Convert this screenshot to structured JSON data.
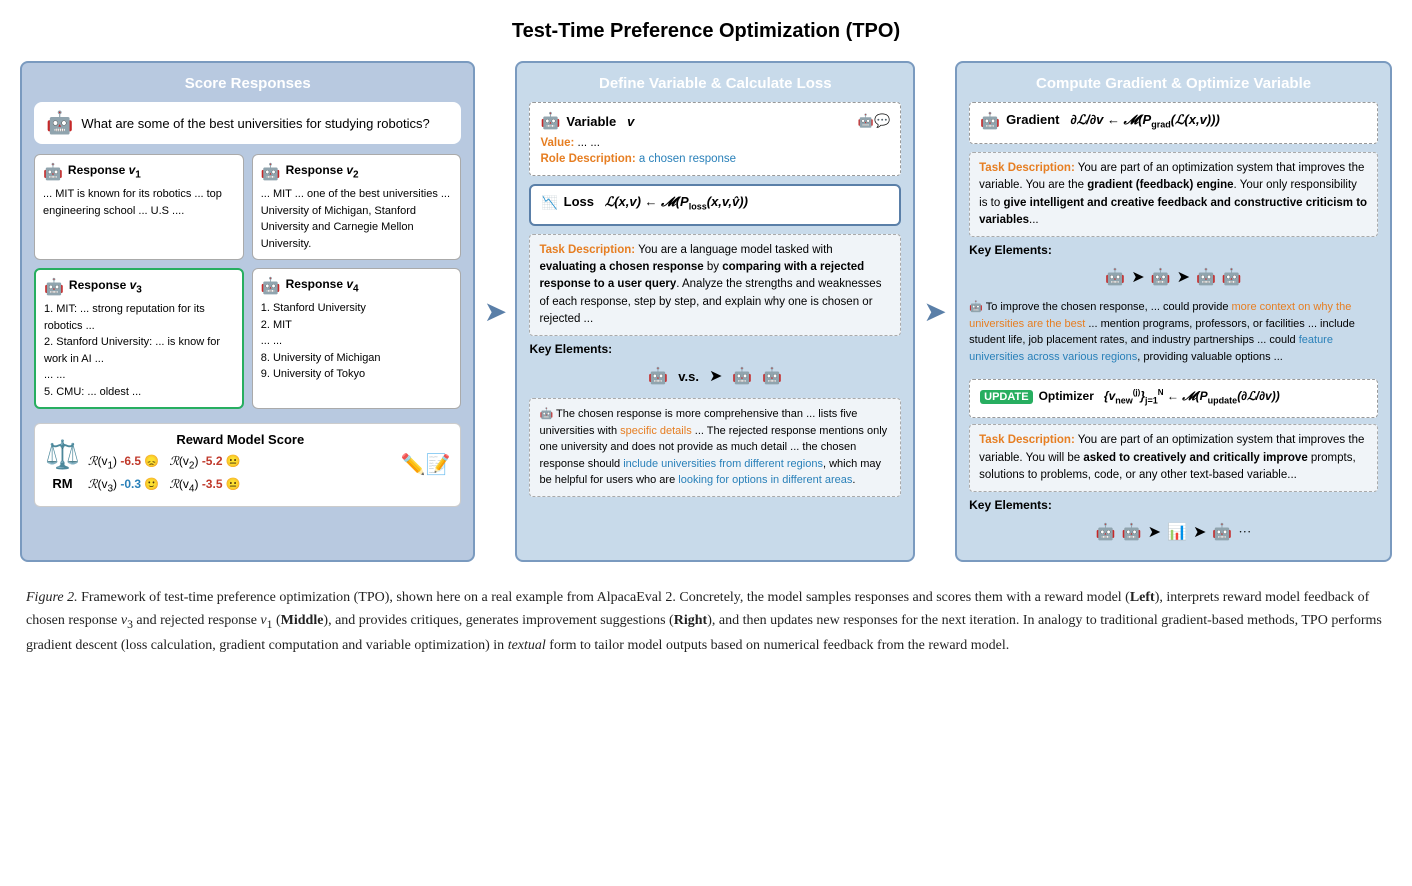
{
  "page": {
    "title": "Test-Time Preference Optimization (TPO)"
  },
  "left_panel": {
    "title": "Score Responses",
    "question": "What are some of the best universities for studying robotics?",
    "responses": [
      {
        "label": "Response",
        "subscript": "v₁",
        "text": "... MIT is known for its robotics ... top engineering school ... U.S ...."
      },
      {
        "label": "Response",
        "subscript": "v₂",
        "text": "... MIT ... one of the best universities ... University of Michigan, Stanford University and Carnegie Mellon University."
      },
      {
        "label": "Response",
        "subscript": "v₃",
        "text": "1. MIT: ... strong reputation for its robotics ...\n2. Stanford University: ... is know for work in AI ...\n... ...\n5. CMU: ... oldest ..."
      },
      {
        "label": "Response",
        "subscript": "v₄",
        "text": "1. Stanford University\n2. MIT\n... ...\n8. University of Michigan\n9. University of Tokyo"
      }
    ],
    "reward_title": "Reward Model Score",
    "scores": [
      {
        "label": "ℛ(v₁)",
        "value": "-6.5",
        "emoji": "😞"
      },
      {
        "label": "ℛ(v₂)",
        "value": "-5.2",
        "emoji": "😐"
      },
      {
        "label": "ℛ(v₃)",
        "value": "-0.3",
        "emoji": "🙂"
      },
      {
        "label": "ℛ(v₄)",
        "value": "-3.5",
        "emoji": "😐"
      }
    ]
  },
  "middle_panel": {
    "title": "Define Variable & Calculate Loss",
    "variable_label": "Variable",
    "variable_var": "v",
    "value_label": "Value:",
    "value_text": "... ...",
    "role_label": "Role Description:",
    "role_text": "a chosen response",
    "loss_label": "Loss",
    "loss_formula": "ℒ(x,v) ← 𝓜(P_loss(x,v,v̂))",
    "task_desc_loss": "Task Description: You are a language model tasked with evaluating a chosen response by comparing with a rejected response to a user query. Analyze the strengths and weaknesses of each response, step by step, and explain why one is chosen or rejected ...",
    "key_elements": "Key Elements:",
    "chosen_feedback": "The chosen response is more comprehensive than ... lists five universities with specific details ... The rejected response mentions only one university and does not provide as much detail ... the chosen response should include universities from different regions, which may be helpful for users who are looking for options in different areas."
  },
  "right_panel": {
    "title": "Compute Gradient & Optimize Variable",
    "gradient_label": "Gradient",
    "gradient_formula": "∂ℒ/∂v ← 𝓜(P_grad(ℒ(x,v)))",
    "task_desc_gradient": "Task Description: You are part of an optimization system that improves the variable. You are the gradient (feedback) engine. Your only responsibility is to give intelligent and creative feedback and constructive criticism to variables...",
    "key_elements_gradient": "Key Elements:",
    "improvement_text": "To improve the chosen response, ... could provide more context on why the universities are the best ... mention programs, professors, or facilities ... include student life, job placement rates, and industry partnerships ... could feature universities across various regions, providing valuable options ...",
    "optimizer_label": "Optimizer",
    "optimizer_formula": "{v_new^(j)}_{j=1}^N ← 𝓜(P_update(∂ℒ/∂v))",
    "task_desc_optimizer": "Task Description: You are part of an optimization system that improves the variable. You will be asked to creatively and critically improve prompts, solutions to problems, code, or any other text-based variable...",
    "key_elements_optimizer": "Key Elements:"
  },
  "caption": {
    "fig_label": "Figure 2.",
    "text": " Framework of test-time preference optimization (TPO), shown here on a real example from AlpacaEval 2. Concretely, the model samples responses and scores them with a reward model (",
    "left_bold": "Left",
    "text2": "), interprets reward model feedback of chosen response ",
    "v3_italic": "v₃",
    "text3": " and rejected response ",
    "v1_italic": "v₁",
    "text4": " (",
    "middle_bold": "Middle",
    "text5": "), and provides critiques, generates improvement suggestions (",
    "right_bold": "Right",
    "text6": "), and then updates new responses for the next iteration. In analogy to traditional gradient-based methods, TPO performs gradient descent (loss calculation, gradient computation and variable optimization) in ",
    "textual_italic": "textual",
    "text7": " form to tailor model outputs based on numerical feedback from the reward model."
  }
}
